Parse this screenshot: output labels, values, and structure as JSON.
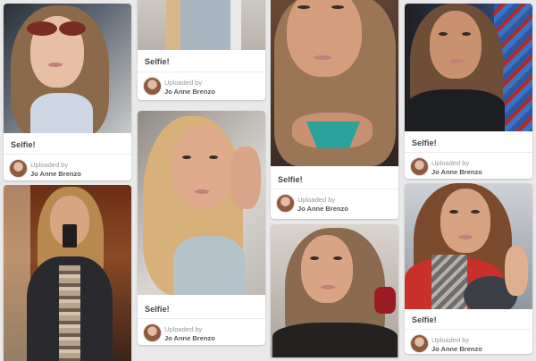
{
  "pins": [
    {
      "id": "c1p1",
      "caption": "Selfie!",
      "uploaded_label": "Uploaded by",
      "uploader": "Jo Anne Brenzo"
    },
    {
      "id": "c1p2",
      "caption": "",
      "uploaded_label": "",
      "uploader": ""
    },
    {
      "id": "c2p1",
      "caption": "Selfie!",
      "uploaded_label": "Uploaded by",
      "uploader": "Jo Anne Brenzo"
    },
    {
      "id": "c2p2",
      "caption": "Selfie!",
      "uploaded_label": "Uploaded by",
      "uploader": "Jo Anne Brenzo"
    },
    {
      "id": "c3p1",
      "caption": "Selfie!",
      "uploaded_label": "Uploaded by",
      "uploader": "Jo Anne Brenzo"
    },
    {
      "id": "c3p2",
      "caption": "",
      "uploaded_label": "",
      "uploader": ""
    },
    {
      "id": "c4p1",
      "caption": "Selfie!",
      "uploaded_label": "Uploaded by",
      "uploader": "Jo Anne Brenzo"
    },
    {
      "id": "c4p2",
      "caption": "Selfie!",
      "uploaded_label": "Uploaded by",
      "uploader": "Jo Anne Brenzo"
    }
  ],
  "colors": {
    "background": "#e9e9e9",
    "card": "#ffffff",
    "caption_text": "#444444",
    "uploader_text": "#555555"
  }
}
